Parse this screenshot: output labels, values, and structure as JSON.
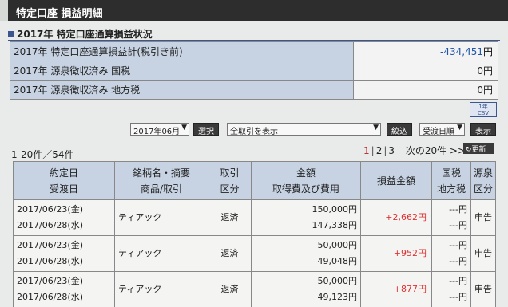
{
  "window": {
    "title": "特定口座 損益明細"
  },
  "section": {
    "title": "2017年 特定口座通算損益状況"
  },
  "summary": [
    {
      "label": "2017年 特定口座通算損益計(税引き前)",
      "value": "-434,451",
      "unit": "円"
    },
    {
      "label": "2017年 源泉徴収済み 国税",
      "value": "0",
      "unit": "円"
    },
    {
      "label": "2017年 源泉徴収済み 地方税",
      "value": "0",
      "unit": "円"
    }
  ],
  "csv": {
    "line1": "1年",
    "line2": "CSV"
  },
  "filters": {
    "month": "2017年06月",
    "select_btn": "選択",
    "trade_type": "全取引を表示",
    "narrow_btn": "絞込",
    "sort_order": "受渡日順",
    "display_btn": "表示"
  },
  "count_text": "1-20件／54件",
  "pager": {
    "p1": "1",
    "p2": "2",
    "p3": "3",
    "next": "次の20件 >>",
    "refresh": "更新"
  },
  "table": {
    "headers": {
      "date1": "約定日",
      "date2": "受渡日",
      "name1": "銘柄名・摘要",
      "name2": "商品/取引",
      "kind1": "取引",
      "kind2": "区分",
      "amt1": "金額",
      "amt2": "取得費及び費用",
      "pl": "損益金額",
      "tax1": "国税",
      "tax2": "地方税",
      "src1": "源泉",
      "src2": "区分"
    },
    "rows": [
      {
        "trade_date": "2017/06/23(金)",
        "settle_date": "2017/06/28(水)",
        "name": "ティアック",
        "kind": "返済",
        "amount": "150,000円",
        "cost": "147,338円",
        "pl": "+2,662円",
        "tax1": "---円",
        "tax2": "---円",
        "src": "申告"
      },
      {
        "trade_date": "2017/06/23(金)",
        "settle_date": "2017/06/28(水)",
        "name": "ティアック",
        "kind": "返済",
        "amount": "50,000円",
        "cost": "49,048円",
        "pl": "+952円",
        "tax1": "---円",
        "tax2": "---円",
        "src": "申告"
      },
      {
        "trade_date": "2017/06/23(金)",
        "settle_date": "2017/06/28(水)",
        "name": "ティアック",
        "kind": "返済",
        "amount": "50,000円",
        "cost": "49,123円",
        "pl": "+877円",
        "tax1": "---円",
        "tax2": "---円",
        "src": "申告"
      }
    ]
  }
}
